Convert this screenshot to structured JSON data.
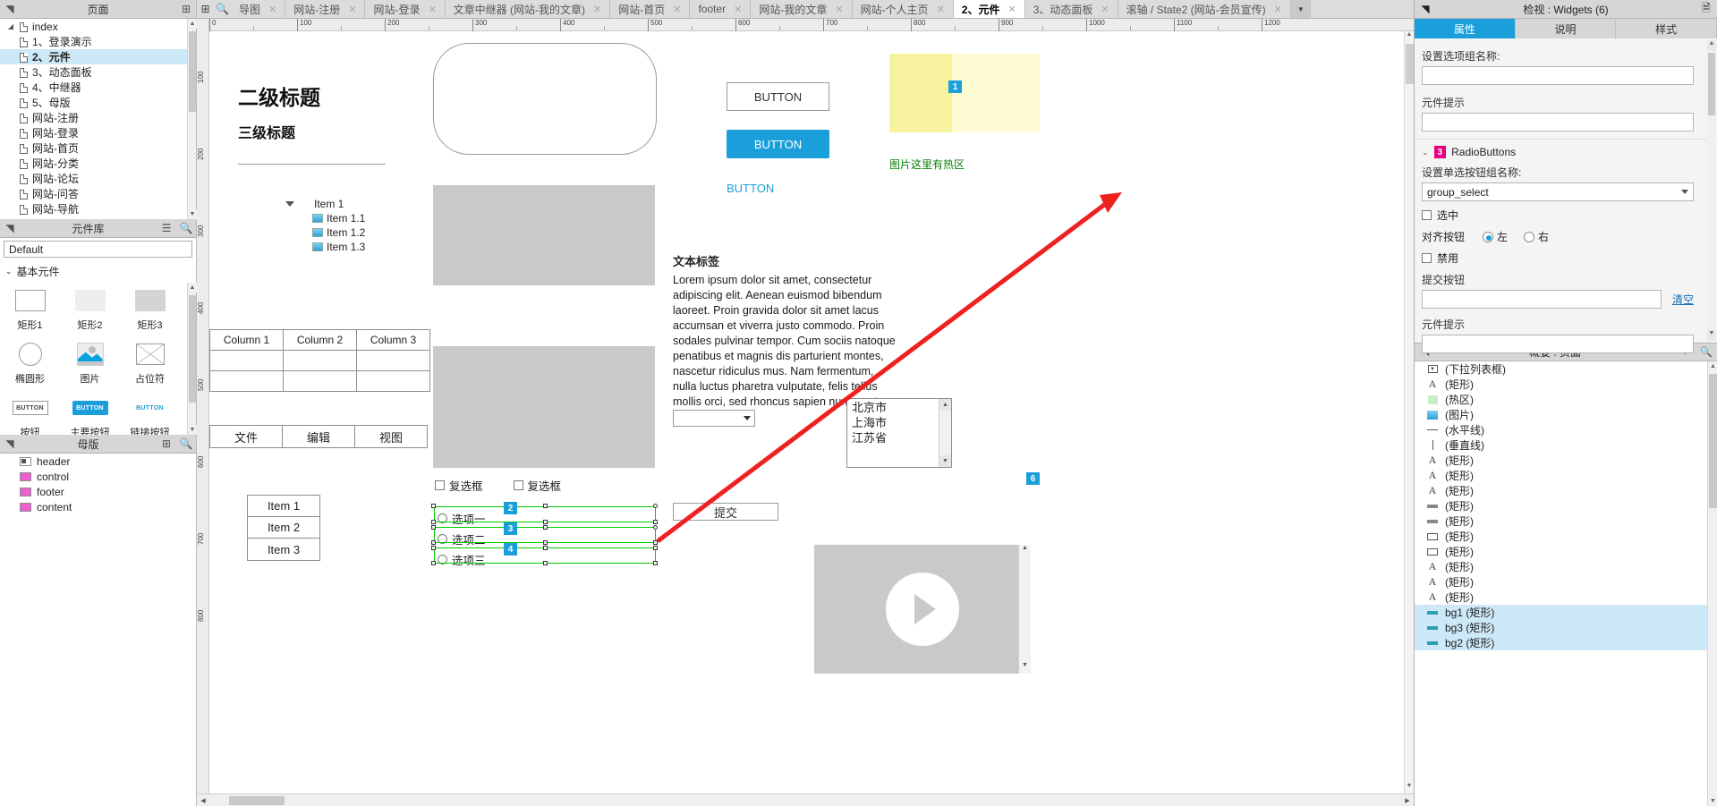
{
  "pages_panel": {
    "title": "页面",
    "add_icon": "add-page-icon",
    "arrow_icon": "collapse-icon",
    "tree": [
      {
        "label": "index",
        "level": 0,
        "expander": "▲",
        "selected": false
      },
      {
        "label": "1、登录演示",
        "level": 1,
        "selected": false
      },
      {
        "label": "2、元件",
        "level": 1,
        "selected": true
      },
      {
        "label": "3、动态面板",
        "level": 1,
        "selected": false
      },
      {
        "label": "4、中继器",
        "level": 1,
        "selected": false
      },
      {
        "label": "5、母版",
        "level": 1,
        "selected": false
      },
      {
        "label": "网站-注册",
        "level": 1,
        "selected": false
      },
      {
        "label": "网站-登录",
        "level": 1,
        "selected": false
      },
      {
        "label": "网站-首页",
        "level": 1,
        "selected": false
      },
      {
        "label": "网站-分类",
        "level": 1,
        "selected": false
      },
      {
        "label": "网站-论坛",
        "level": 1,
        "selected": false
      },
      {
        "label": "网站-问答",
        "level": 1,
        "selected": false
      },
      {
        "label": "网站-导航",
        "level": 1,
        "selected": false
      }
    ]
  },
  "library_panel": {
    "title": "元件库",
    "menu_icon": "library-menu-icon",
    "search_icon": "search-icon",
    "selected_library": "Default",
    "group_label": "基本元件",
    "items": [
      {
        "caption": "矩形1",
        "icon": "rectangle-1-icon"
      },
      {
        "caption": "矩形2",
        "icon": "rectangle-2-icon"
      },
      {
        "caption": "矩形3",
        "icon": "rectangle-3-icon"
      },
      {
        "caption": "椭圆形",
        "icon": "ellipse-icon"
      },
      {
        "caption": "图片",
        "icon": "image-icon"
      },
      {
        "caption": "占位符",
        "icon": "placeholder-icon"
      },
      {
        "caption": "按钮",
        "icon": "button-icon"
      },
      {
        "caption": "主要按钮",
        "icon": "primary-button-icon"
      },
      {
        "caption": "链接按钮",
        "icon": "link-button-icon"
      }
    ],
    "button_glyph": "BUTTON"
  },
  "masters_panel": {
    "title": "母版",
    "add_icon": "add-master-icon",
    "search_icon": "search-icon",
    "items": [
      {
        "label": "header",
        "icon": "master-header-icon"
      },
      {
        "label": "control",
        "icon": "master-icon"
      },
      {
        "label": "footer",
        "icon": "master-icon"
      },
      {
        "label": "content",
        "icon": "master-icon"
      }
    ]
  },
  "tabbar": {
    "new_tab_icon": "new-tab-icon",
    "search_icon": "search-icon",
    "overflow_icon": "chevron-down-icon",
    "close_glyph": "✕",
    "tabs": [
      {
        "label": "导图",
        "active": false
      },
      {
        "label": "网站-注册",
        "active": false
      },
      {
        "label": "网站-登录",
        "active": false
      },
      {
        "label": "文章中继器 (网站-我的文章)",
        "active": false
      },
      {
        "label": "网站-首页",
        "active": false
      },
      {
        "label": "footer",
        "active": false
      },
      {
        "label": "网站-我的文章",
        "active": false
      },
      {
        "label": "网站-个人主页",
        "active": false
      },
      {
        "label": "2、元件",
        "active": true
      },
      {
        "label": "3、动态面板",
        "active": false
      },
      {
        "label": "滚轴 / State2 (网站-会员宣传)",
        "active": false
      }
    ]
  },
  "rulers": {
    "horizontal_ticks": [
      "0",
      "100",
      "200",
      "300",
      "400",
      "500",
      "600",
      "700",
      "800",
      "900",
      "1000",
      "1100",
      "1200"
    ],
    "vertical_ticks": [
      "100",
      "200",
      "300",
      "400",
      "500",
      "600",
      "700",
      "800"
    ]
  },
  "canvas": {
    "heading_1": "二级标题",
    "heading_2": "三级标题",
    "button_outline": "BUTTON",
    "button_primary": "BUTTON",
    "button_link": "BUTTON",
    "hotspot_note": "图片这里有热区",
    "hotspot_badge": "1",
    "tree_widget": [
      {
        "label": "Item 1",
        "level": 0
      },
      {
        "label": "Item 1.1",
        "level": 1
      },
      {
        "label": "Item 1.2",
        "level": 1
      },
      {
        "label": "Item 1.3",
        "level": 1
      }
    ],
    "table": {
      "headers": [
        "Column 1",
        "Column 2",
        "Column 3"
      ],
      "rows": [
        [
          "",
          "",
          ""
        ],
        [
          "",
          "",
          ""
        ]
      ]
    },
    "menu": [
      "文件",
      "编辑",
      "视图"
    ],
    "listbox_items": [
      "Item 1",
      "Item 2",
      "Item 3"
    ],
    "text_label_title": "文本标签",
    "paragraph": "Lorem ipsum dolor sit amet, consectetur adipiscing elit. Aenean euismod bibendum laoreet. Proin gravida dolor sit amet lacus accumsan et viverra justo commodo. Proin sodales pulvinar tempor. Cum sociis natoque penatibus et magnis dis parturient montes, nascetur ridiculus mus. Nam fermentum, nulla luctus pharetra vulputate, felis tellus mollis orci, sed rhoncus sapien nunc eget.",
    "multiselect_items": [
      "北京市",
      "上海市",
      "江苏省"
    ],
    "checkboxes": [
      "复选框",
      "复选框"
    ],
    "radios": [
      "选项一",
      "选项二",
      "选项三"
    ],
    "radio_badges": [
      "2",
      "3",
      "4"
    ],
    "submit_button": "提交",
    "video_badge": "6",
    "play_icon": "play-icon"
  },
  "inspector": {
    "title": "检视 : Widgets (6)",
    "doc_icon": "note-icon",
    "collapse_icon": "collapse-icon",
    "tabs": [
      {
        "label": "属性",
        "active": true
      },
      {
        "label": "说明",
        "active": false
      },
      {
        "label": "样式",
        "active": false
      }
    ],
    "option_group_label": "设置选项组名称:",
    "option_group_value": "",
    "tip_label": "元件提示",
    "tip_value": "",
    "section": {
      "number": "3",
      "title": "RadioButtons",
      "radio_group_label": "设置单选按钮组名称:",
      "radio_group_value": "group_select",
      "checked_label": "选中",
      "align_label": "对齐按钮",
      "align_left": "左",
      "align_right": "右",
      "align_selected": "左",
      "disabled_label": "禁用",
      "submit_label": "提交按钮",
      "submit_value": "",
      "clear_link": "清空",
      "tip_label": "元件提示",
      "tip_value": ""
    }
  },
  "outline_panel": {
    "title": "概要 : 页面",
    "filter_icon": "filter-icon",
    "search_icon": "search-icon",
    "collapse_icon": "collapse-icon",
    "items": [
      {
        "label": "(下拉列表框)",
        "icon": "dropdown-icon",
        "highlight": false
      },
      {
        "label": "(矩形)",
        "icon": "text-icon",
        "highlight": false
      },
      {
        "label": "(热区)",
        "icon": "hotspot-icon",
        "highlight": false
      },
      {
        "label": "(图片)",
        "icon": "image-icon",
        "highlight": false
      },
      {
        "label": "(水平线)",
        "icon": "hline-icon",
        "highlight": false
      },
      {
        "label": "(垂直线)",
        "icon": "vline-icon",
        "highlight": false
      },
      {
        "label": "(矩形)",
        "icon": "text-icon",
        "highlight": false
      },
      {
        "label": "(矩形)",
        "icon": "text-icon",
        "highlight": false
      },
      {
        "label": "(矩形)",
        "icon": "text-icon",
        "highlight": false
      },
      {
        "label": "(矩形)",
        "icon": "bar-icon",
        "highlight": false
      },
      {
        "label": "(矩形)",
        "icon": "bar-icon",
        "highlight": false
      },
      {
        "label": "(矩形)",
        "icon": "rect-icon",
        "highlight": false
      },
      {
        "label": "(矩形)",
        "icon": "rect-icon",
        "highlight": false
      },
      {
        "label": "(矩形)",
        "icon": "text-icon",
        "highlight": false
      },
      {
        "label": "(矩形)",
        "icon": "text-icon",
        "highlight": false
      },
      {
        "label": "(矩形)",
        "icon": "text-icon",
        "highlight": false
      },
      {
        "label": "bg1 (矩形)",
        "icon": "bar-teal-icon",
        "highlight": true
      },
      {
        "label": "bg3 (矩形)",
        "icon": "bar-teal-icon",
        "highlight": true
      },
      {
        "label": "bg2 (矩形)",
        "icon": "bar-teal-icon",
        "highlight": true
      }
    ]
  },
  "colors": {
    "accent": "#1a9fdb",
    "selection_green": "#00cc00",
    "annotation_red": "#ef2020",
    "badge_pink": "#e6007e",
    "highlight_row": "#cde8f6"
  }
}
